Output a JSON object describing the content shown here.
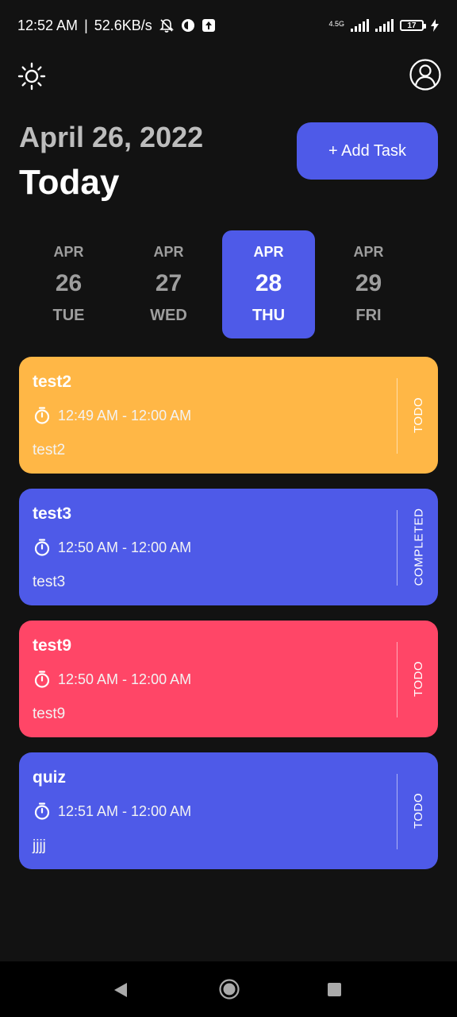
{
  "status_bar": {
    "time": "12:52 AM",
    "separator": "|",
    "speed": "52.6KB/s",
    "network": "4.5G",
    "battery": "17"
  },
  "header": {
    "date": "April 26, 2022",
    "title": "Today",
    "add_task_label": "+ Add Task"
  },
  "dates": [
    {
      "month": "APR",
      "day": "26",
      "weekday": "TUE",
      "selected": false
    },
    {
      "month": "APR",
      "day": "27",
      "weekday": "WED",
      "selected": false
    },
    {
      "month": "APR",
      "day": "28",
      "weekday": "THU",
      "selected": true
    },
    {
      "month": "APR",
      "day": "29",
      "weekday": "FRI",
      "selected": false
    }
  ],
  "tasks": [
    {
      "title": "test2",
      "time": "12:49 AM - 12:00 AM",
      "note": "test2",
      "status": "TODO",
      "color": "#ffb746"
    },
    {
      "title": "test3",
      "time": "12:50 AM - 12:00 AM",
      "note": "test3",
      "status": "COMPLETED",
      "color": "#4e5ae8"
    },
    {
      "title": "test9",
      "time": "12:50 AM - 12:00 AM",
      "note": "test9",
      "status": "TODO",
      "color": "#ff4667"
    },
    {
      "title": "quiz",
      "time": "12:51 AM - 12:00 AM",
      "note": "jjjj",
      "status": "TODO",
      "color": "#4e5ae8"
    }
  ],
  "colors": {
    "background": "#121212",
    "accent": "#4e5ae8"
  },
  "icons": {
    "theme_toggle": "sun-icon",
    "profile": "person-outline-icon",
    "time": "timer-icon"
  }
}
